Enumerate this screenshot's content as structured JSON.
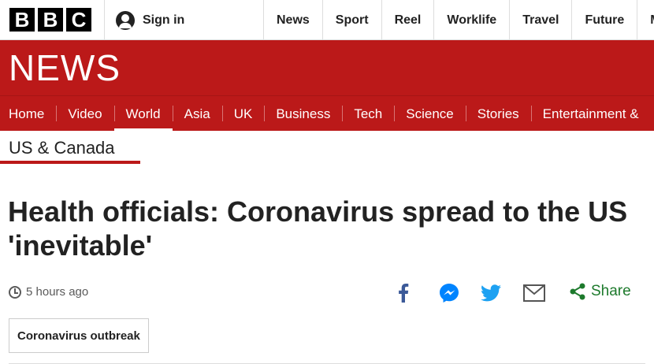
{
  "logo": {
    "letters": [
      "B",
      "B",
      "C"
    ]
  },
  "account": {
    "sign_in_label": "Sign in"
  },
  "top_nav": [
    {
      "label": "News"
    },
    {
      "label": "Sport"
    },
    {
      "label": "Reel"
    },
    {
      "label": "Worklife"
    },
    {
      "label": "Travel"
    },
    {
      "label": "Future"
    },
    {
      "label": "M"
    }
  ],
  "banner": {
    "title": "NEWS"
  },
  "section_nav": [
    {
      "label": "Home"
    },
    {
      "label": "Video"
    },
    {
      "label": "World",
      "active": true
    },
    {
      "label": "Asia"
    },
    {
      "label": "UK"
    },
    {
      "label": "Business"
    },
    {
      "label": "Tech"
    },
    {
      "label": "Science"
    },
    {
      "label": "Stories"
    },
    {
      "label": "Entertainment &"
    }
  ],
  "subsection": {
    "label": "US & Canada"
  },
  "article": {
    "headline": "Health officials: Coronavirus spread to the US 'inevitable'",
    "timestamp": "5 hours ago",
    "tag": "Coronavirus outbreak"
  },
  "share": {
    "label": "Share",
    "services": [
      "facebook-icon",
      "messenger-icon",
      "twitter-icon",
      "email-icon"
    ]
  },
  "colors": {
    "brand_red": "#bb1919",
    "share_green": "#1d7a2c",
    "facebook_blue": "#3b5998",
    "messenger_blue": "#0084ff",
    "twitter_blue": "#1da1f2"
  }
}
